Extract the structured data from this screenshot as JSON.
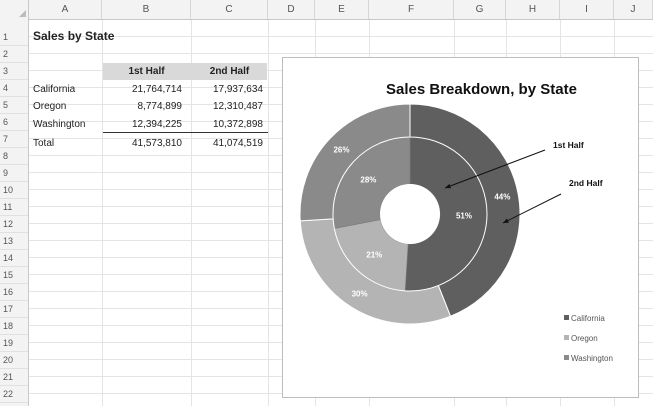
{
  "columns": [
    "A",
    "B",
    "C",
    "D",
    "E",
    "F",
    "G",
    "H",
    "I",
    "J"
  ],
  "rows": [
    "1",
    "2",
    "3",
    "4",
    "5",
    "6",
    "7",
    "8",
    "9",
    "10",
    "11",
    "12",
    "13",
    "14",
    "15",
    "16",
    "17",
    "18",
    "19",
    "20",
    "21",
    "22"
  ],
  "sheet": {
    "title": "Sales by State",
    "headers": [
      "1st Half",
      "2nd Half"
    ],
    "data_rows": [
      {
        "label": "California",
        "h1": "21,764,714",
        "h2": "17,937,634"
      },
      {
        "label": "Oregon",
        "h1": "8,774,899",
        "h2": "12,310,487"
      },
      {
        "label": "Washington",
        "h1": "12,394,225",
        "h2": "10,372,898"
      }
    ],
    "total": {
      "label": "Total",
      "h1": "41,573,810",
      "h2": "41,074,519"
    }
  },
  "chart_data": {
    "type": "pie",
    "subtype": "doughnut",
    "title": "Sales Breakdown, by State",
    "categories": [
      "California",
      "Oregon",
      "Washington"
    ],
    "series": [
      {
        "name": "1st Half",
        "values": [
          51,
          21,
          28
        ],
        "labels": [
          "51%",
          "21%",
          "28%"
        ]
      },
      {
        "name": "2nd Half",
        "values": [
          44,
          30,
          26
        ],
        "labels": [
          "44%",
          "30%",
          "26%"
        ]
      }
    ],
    "colors": [
      "#5f5f5f",
      "#b4b4b4",
      "#8a8a8a"
    ],
    "legend": "right",
    "callouts": [
      "1st Half",
      "2nd Half"
    ]
  }
}
